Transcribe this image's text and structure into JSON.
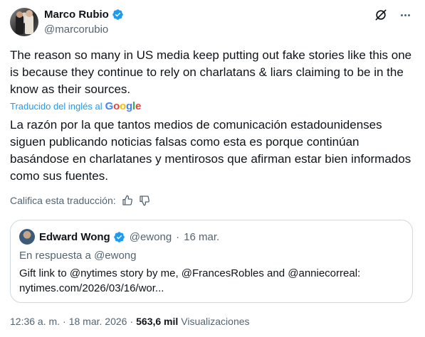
{
  "author": {
    "name": "Marco Rubio",
    "handle": "@marcorubio"
  },
  "icons": {
    "verified": "verified-badge-icon",
    "grok": "grok-icon",
    "more": "more-options-icon",
    "thumbs_up": "thumbs-up-icon",
    "thumbs_down": "thumbs-down-icon"
  },
  "colors": {
    "accent": "#1d9bf0",
    "text": "#0f1419",
    "muted": "#536471",
    "border": "#cfd9de"
  },
  "tweet": {
    "text": "The reason so many in US media keep putting out fake stories like this one is because they continue to rely on charlatans & liars claiming to be in the know as their sources.",
    "translated_label": "Traducido del inglés al",
    "translator_brand": "Google",
    "translation": "La razón por la que tantos medios de comunicación estadounidenses siguen publicando noticias falsas como esta es porque continúan basándose en charlatanes y mentirosos que afirman estar bien informados como sus fuentes.",
    "rate_label": "Califica esta traducción:"
  },
  "quote": {
    "name": "Edward Wong",
    "handle": "@ewong",
    "separator": "·",
    "date": "16 mar.",
    "reply_to": "En respuesta a @ewong",
    "text": "Gift link to @nytimes story by me, @FrancesRobles and @anniecorreal: nytimes.com/2026/03/16/wor..."
  },
  "footer": {
    "time": "12:36 a. m.",
    "separator": "·",
    "date": "18 mar. 2026",
    "views_count": "563,6 mil",
    "views_label": "Visualizaciones"
  }
}
